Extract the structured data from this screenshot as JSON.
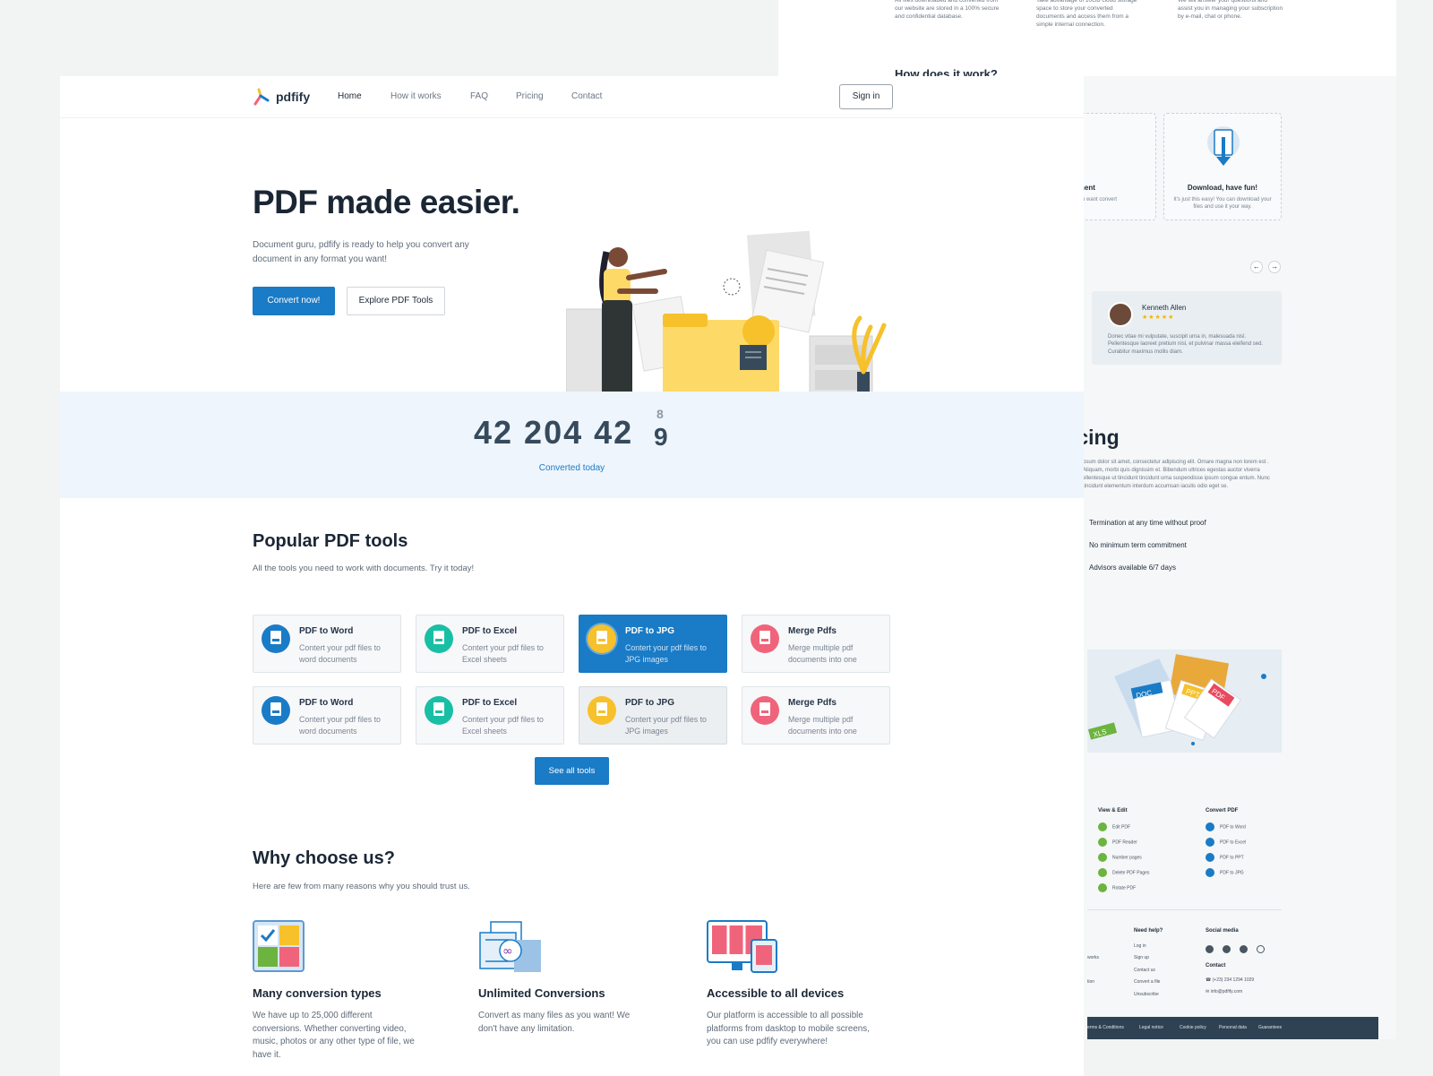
{
  "background_page": {
    "features_top": [
      "All files downloaded and converted from our website are stored in a 100% secure and confidential database.",
      "Take advantage of 10GB cloud storage space to store your converted documents and access them from a simple internal connection.",
      "We will answer your questions and assist you in managing your subscription by e-mail, chat or phone."
    ],
    "how_title": "How does it work?",
    "steps": [
      {
        "title": "red document",
        "desc": "r document you want convert"
      },
      {
        "title": "Download, have fun!",
        "desc": "It's just this easy! You can download your files and use it your way."
      }
    ],
    "testimonial": {
      "name": "Kenneth Allen",
      "stars": "★★★★★",
      "text": "Donec vitae mi vulputate, suscipit urna in, malesuada nisl. Pellentesque laoreet pretium nisl, et pulvinar massa eleifend sed. Curabitur maximus mollis diam."
    },
    "pricing_title": "ricing",
    "pricing_desc": "psum dolor sit amet, consectetur adipiscing elit. Ornare magna non lorem est . Aliquam, morbi quis dignissim et. Bibendum ultrices egestas auctor viverra ellentesque ut tincidunt tincidunt urna suspendisse ipsum congue entum. Nunc tincidunt elementum interdum accumsan iaculis odio eget se.",
    "pricing_features": [
      "Termination at any time without proof",
      "No minimum term commitment",
      "Advisors available 6/7 days"
    ],
    "file_tags": [
      "DOC",
      "PPT",
      "PDF",
      "XLS"
    ],
    "footer": {
      "col1_title": "View & Edit",
      "col1_links": [
        "Edit PDF",
        "PDF Reader",
        "Number pages",
        "Delete PDF Pages",
        "Rotate PDF"
      ],
      "col2_title": "Convert PDF",
      "col2_links": [
        "PDF to Word",
        "PDF to Excel",
        "PDF to PPT",
        "PDF to JPG"
      ],
      "help_title": "Need help?",
      "help_links": [
        "Log in",
        "Sign up",
        "Contact us",
        "Convert a file",
        "Unsubscribe"
      ],
      "left_fragments": [
        "works",
        "tion"
      ],
      "social_title": "Social media",
      "contact_title": "Contact",
      "phone": "(+23) 234 1294 1029",
      "email": "info@pdfify.com",
      "bottom_links": [
        "erms & Conditions",
        "Legal notice",
        "Cookie policy",
        "Personal data",
        "Guarantees"
      ]
    },
    "accent_colors": {
      "green": "#6cb33f",
      "blue": "#1a7bc6"
    }
  },
  "nav": {
    "logo": "pdfify",
    "links": [
      "Home",
      "How it works",
      "FAQ",
      "Pricing",
      "Contact"
    ],
    "active": "Home",
    "signin": "Sign in"
  },
  "hero": {
    "title": "PDF made easier.",
    "subtitle": "Document guru, pdfify is ready to help you convert any document in any format you want!",
    "primary_button": "Convert now!",
    "secondary_button": "Explore PDF Tools"
  },
  "counter": {
    "value": "42 204 42",
    "rolling_prev": "8",
    "rolling_current": "9",
    "label": "Converted today"
  },
  "tools_section": {
    "title": "Popular PDF tools",
    "subtitle": "All the tools you need to work with documents. Try it today!",
    "tools": [
      {
        "name": "PDF to Word",
        "desc": "Contert your pdf files to word documents",
        "color": "#1a7bc6",
        "icon": "docx-file-icon"
      },
      {
        "name": "PDF to Excel",
        "desc": "Contert your pdf files to Excel sheets",
        "color": "#19bfa5",
        "icon": "xls-file-icon"
      },
      {
        "name": "PDF to JPG",
        "desc": "Contert your pdf files to JPG images",
        "color": "#f6c12b",
        "icon": "jpg-file-icon"
      },
      {
        "name": "Merge Pdfs",
        "desc": "Merge multiple pdf documents into one",
        "color": "#f0647b",
        "icon": "pdf-file-icon"
      },
      {
        "name": "PDF to Word",
        "desc": "Contert your pdf files to word documents",
        "color": "#1a7bc6",
        "icon": "docx-file-icon"
      },
      {
        "name": "PDF to Excel",
        "desc": "Contert your pdf files to Excel sheets",
        "color": "#19bfa5",
        "icon": "xls-file-icon"
      },
      {
        "name": "PDF to JPG",
        "desc": "Contert your pdf files to JPG images",
        "color": "#f6c12b",
        "icon": "jpg-file-icon"
      },
      {
        "name": "Merge Pdfs",
        "desc": "Merge multiple pdf documents into one",
        "color": "#f0647b",
        "icon": "pdf-file-icon"
      }
    ],
    "see_all": "See all tools"
  },
  "why_section": {
    "title": "Why choose us?",
    "subtitle": "Here are few from many reasons why you should trust us.",
    "items": [
      {
        "title": "Many conversion types",
        "desc": "We have up to 25,000 different conversions. Whether converting video, music, photos or any other type of file, we have it."
      },
      {
        "title": "Unlimited Conversions",
        "desc": "Convert as many files as you want! We don't have any limitation."
      },
      {
        "title": "Accessible to all devices",
        "desc": "Our platform is accessible to all possible platforms from dasktop to mobile screens, you can use pdfify everywhere!"
      }
    ]
  }
}
